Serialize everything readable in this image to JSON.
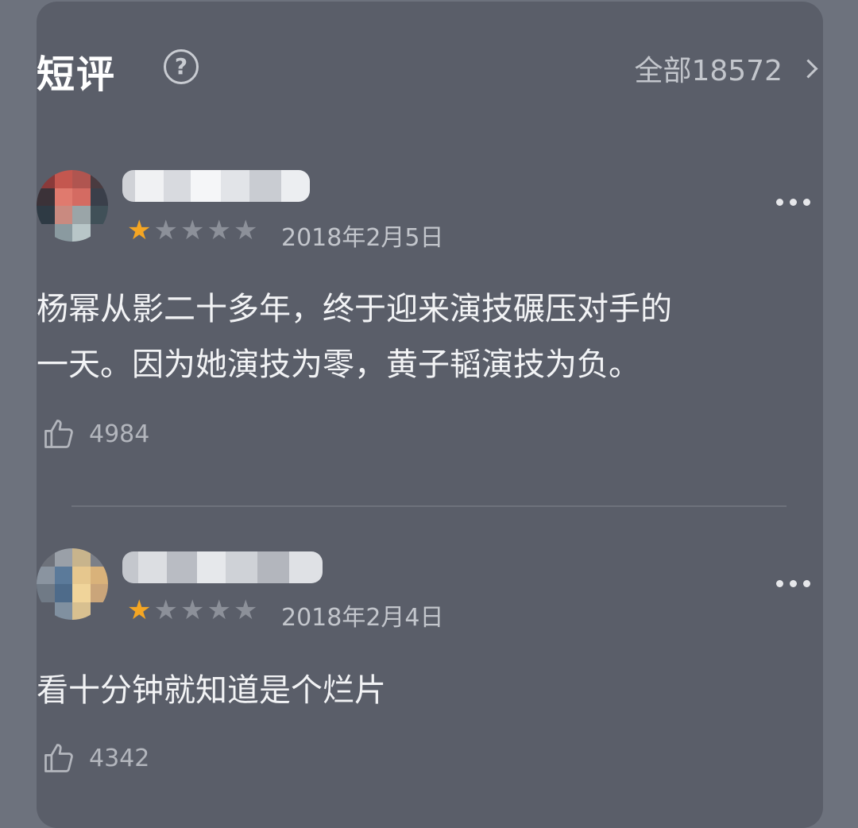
{
  "header": {
    "title": "短评",
    "help_icon": "question-circle-icon",
    "all_label": "全部18572"
  },
  "reviews": [
    {
      "date": "2018年2月5日",
      "rating": 1,
      "max_rating": 5,
      "content_line1": "杨幂从影二十多年，终于迎来演技碾压对手的",
      "content_line2": "一天。因为她演技为零，黄子韬演技为负。",
      "likes": "4984"
    },
    {
      "date": "2018年2月4日",
      "rating": 1,
      "max_rating": 5,
      "content_line1": "看十分钟就知道是个烂片",
      "likes": "4342"
    }
  ],
  "colors": {
    "star_active": "#f5a623",
    "card_bg": "#5a5e69",
    "page_bg": "#6d727d"
  }
}
